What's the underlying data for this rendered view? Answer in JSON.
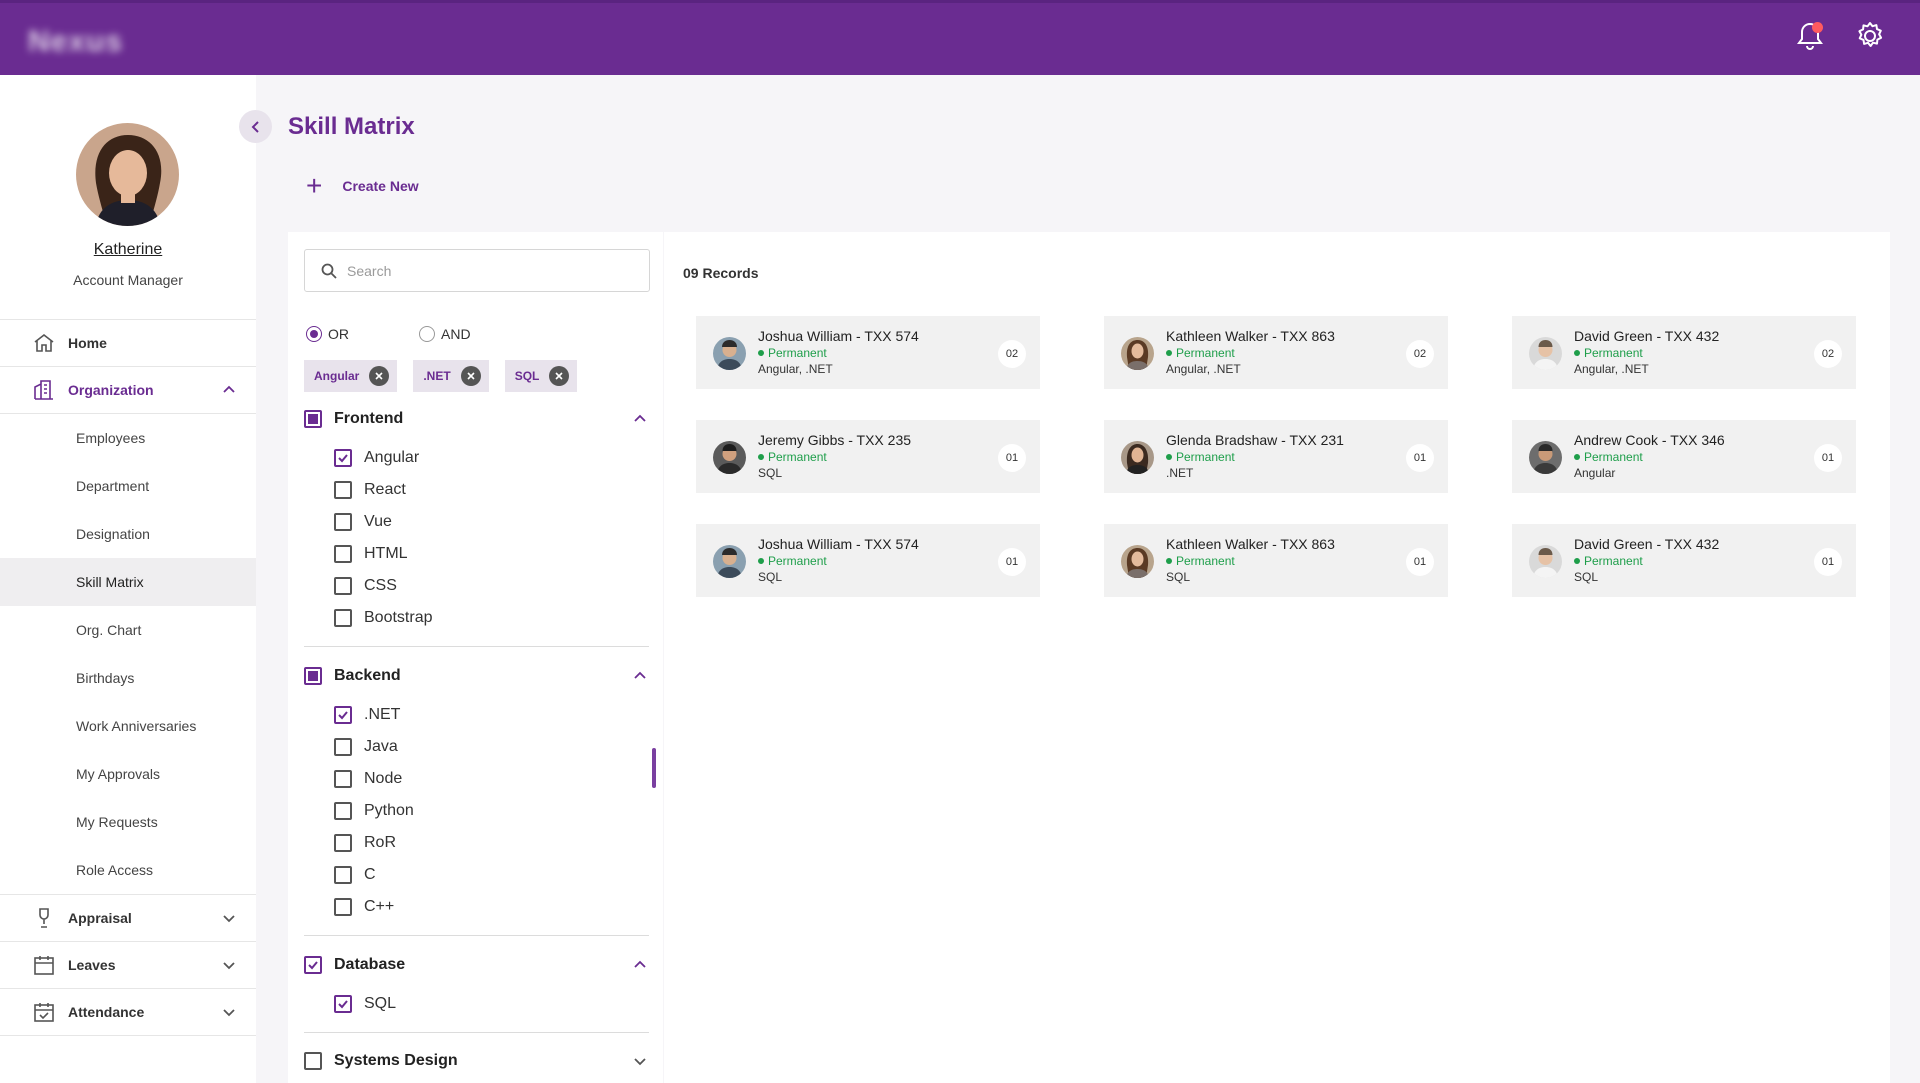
{
  "header": {
    "logo": "Nexus"
  },
  "user": {
    "name": "Katherine",
    "role": "Account Manager"
  },
  "sidebar": {
    "home": "Home",
    "organization": "Organization",
    "sub": [
      "Employees",
      "Department",
      "Designation",
      "Skill Matrix",
      "Org. Chart",
      "Birthdays",
      "Work Anniversaries",
      "My Approvals",
      "My Requests",
      "Role Access"
    ],
    "appraisal": "Appraisal",
    "leaves": "Leaves",
    "attendance": "Attendance"
  },
  "page": {
    "title": "Skill Matrix",
    "create_new": "Create New"
  },
  "filter": {
    "search_placeholder": "Search",
    "or_label": "OR",
    "and_label": "AND",
    "chips": [
      "Angular",
      ".NET",
      "SQL"
    ],
    "groups": [
      {
        "name": "Frontend",
        "items": [
          "Angular",
          "React",
          "Vue",
          "HTML",
          "CSS",
          "Bootstrap"
        ]
      },
      {
        "name": "Backend",
        "items": [
          ".NET",
          "Java",
          "Node",
          "Python",
          "RoR",
          "C",
          "C++"
        ]
      },
      {
        "name": "Database",
        "items": [
          "SQL"
        ]
      },
      {
        "name": "Systems Design",
        "items": []
      }
    ]
  },
  "records": {
    "count_label": "09 Records",
    "cards": [
      {
        "name": "Joshua William - TXX 574",
        "status": "Permanent",
        "skills": "Angular, .NET",
        "count": "02"
      },
      {
        "name": "Kathleen Walker - TXX 863",
        "status": "Permanent",
        "skills": "Angular, .NET",
        "count": "02"
      },
      {
        "name": "David Green - TXX 432",
        "status": "Permanent",
        "skills": "Angular, .NET",
        "count": "02"
      },
      {
        "name": "Jeremy Gibbs - TXX 235",
        "status": "Permanent",
        "skills": "SQL",
        "count": "01"
      },
      {
        "name": "Glenda Bradshaw - TXX 231",
        "status": "Permanent",
        "skills": ".NET",
        "count": "01"
      },
      {
        "name": "Andrew Cook - TXX 346",
        "status": "Permanent",
        "skills": "Angular",
        "count": "01"
      },
      {
        "name": "Joshua William - TXX 574",
        "status": "Permanent",
        "skills": "SQL",
        "count": "01"
      },
      {
        "name": "Kathleen Walker - TXX 863",
        "status": "Permanent",
        "skills": "SQL",
        "count": "01"
      },
      {
        "name": "David Green - TXX 432",
        "status": "Permanent",
        "skills": "SQL",
        "count": "01"
      }
    ]
  },
  "colors": {
    "brand": "#6a2c91",
    "status_green": "#1e9e4a",
    "chip_bg": "#e8e3ec"
  }
}
